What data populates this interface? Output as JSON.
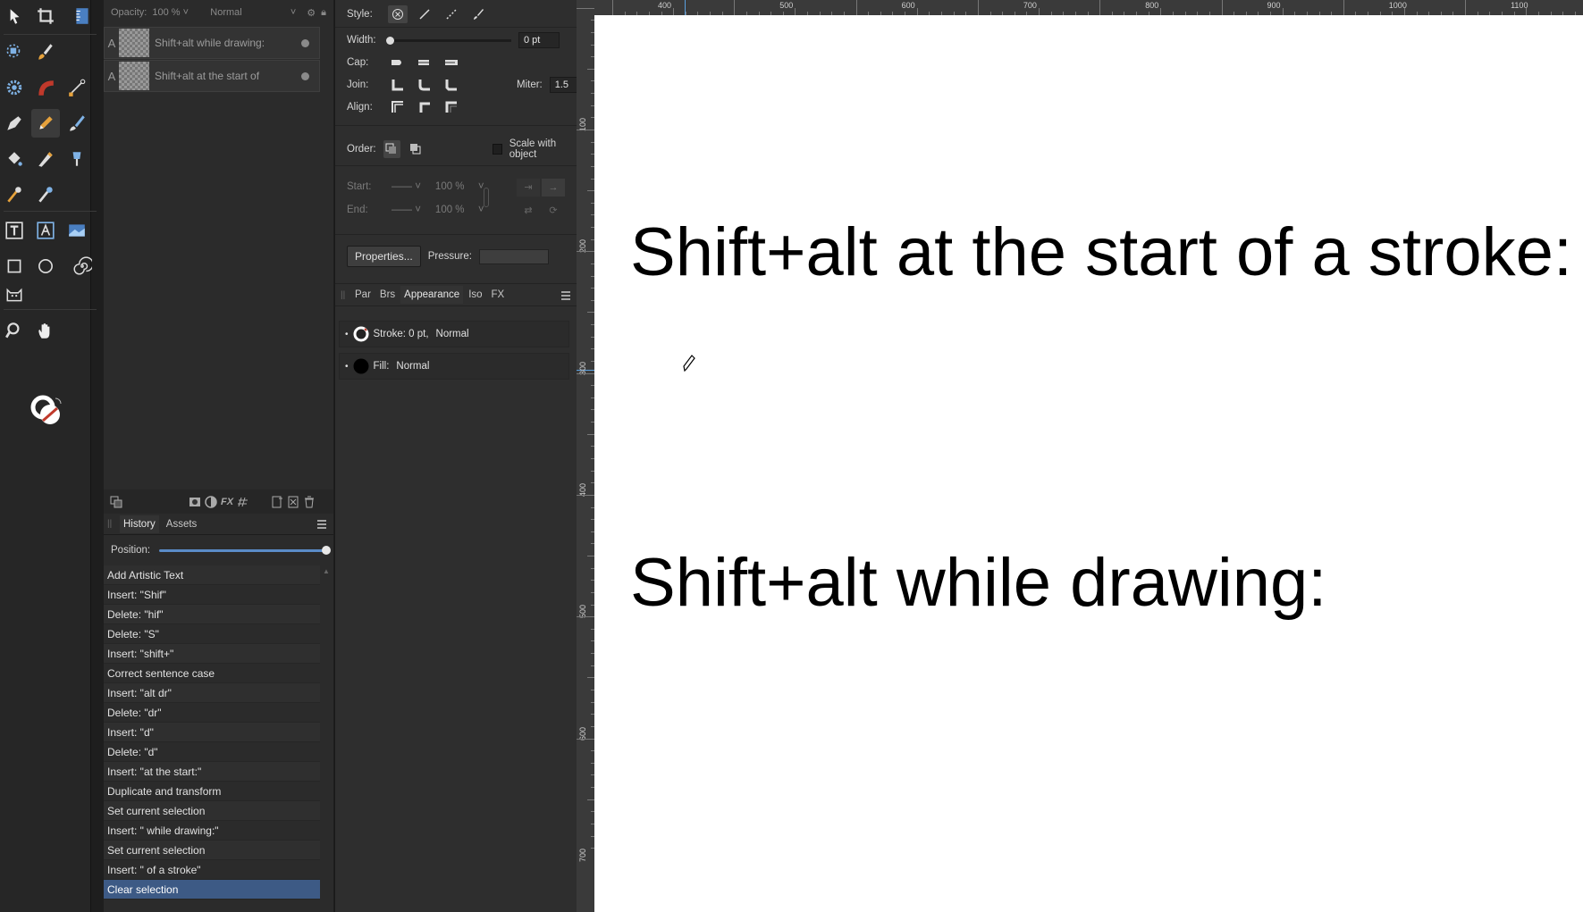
{
  "layers": {
    "opacity_label": "Opacity:",
    "opacity_value": "100 %",
    "blend_mode": "Normal",
    "items": [
      {
        "letter": "A",
        "name": "Shift+alt while drawing:"
      },
      {
        "letter": "A",
        "name": "Shift+alt at the start of"
      }
    ]
  },
  "history": {
    "tabs": [
      "History",
      "Assets"
    ],
    "position_label": "Position:",
    "items": [
      "Add Artistic Text",
      "Insert: \"Shif\"",
      "Delete: \"hif\"",
      "Delete: \"S\"",
      "Insert: \"shift+\"",
      "Correct sentence case",
      "Insert: \"alt dr\"",
      "Delete: \"dr\"",
      "Insert: \"d\"",
      "Delete: \"d\"",
      "Insert: \"at the start:\"",
      "Duplicate and transform",
      "Set current selection",
      "Insert: \" while drawing:\"",
      "Set current selection",
      "Insert: \" of a stroke\"",
      "Clear selection"
    ],
    "selected_index": 16
  },
  "stroke": {
    "style_label": "Style:",
    "width_label": "Width:",
    "width_value": "0 pt",
    "cap_label": "Cap:",
    "join_label": "Join:",
    "miter_label": "Miter:",
    "miter_value": "1.5",
    "align_label": "Align:",
    "order_label": "Order:",
    "scale_label": "Scale with object",
    "start_label": "Start:",
    "start_value": "100 %",
    "end_label": "End:",
    "end_value": "100 %",
    "properties_button": "Properties...",
    "pressure_label": "Pressure:"
  },
  "appearance": {
    "tabs": [
      "Par",
      "Brs",
      "Appearance",
      "Iso",
      "FX"
    ],
    "stroke_label": "Stroke: 0 pt,",
    "stroke_mode": "Normal",
    "fill_label": "Fill:",
    "fill_mode": "Normal"
  },
  "ruler": {
    "unit": "px",
    "h_labels": [
      "400",
      "500",
      "600",
      "700",
      "800",
      "900",
      "1000",
      "1100"
    ],
    "v_labels": [
      "100",
      "200",
      "300",
      "400",
      "500",
      "600",
      "700"
    ]
  },
  "canvas": {
    "text1": "Shift+alt at the start of a stroke:",
    "text2": "Shift+alt while drawing:"
  },
  "colors": {
    "selection": "#3d5a85",
    "accent": "#5a8cc8",
    "brush_accent": "#c0392b"
  }
}
